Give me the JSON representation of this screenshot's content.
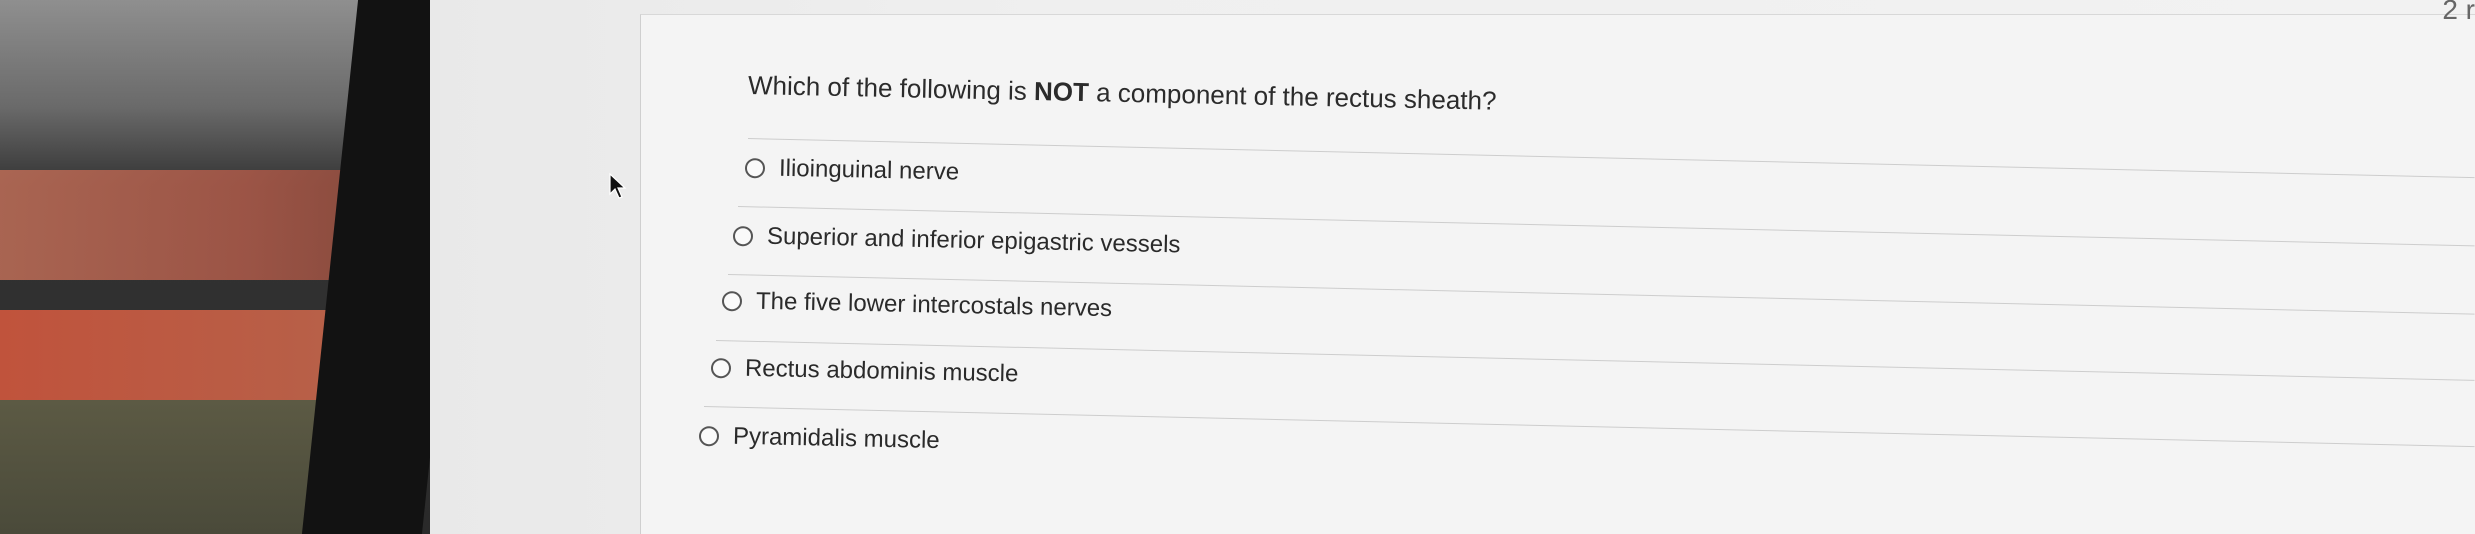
{
  "question": {
    "prefix": "Which of the following is ",
    "emphasis": "NOT",
    "suffix": " a component of the rectus sheath?"
  },
  "options": [
    {
      "label": "Ilioinguinal nerve",
      "selected": false
    },
    {
      "label": "Superior and inferior epigastric vessels",
      "selected": false
    },
    {
      "label": "The five lower intercostals nerves",
      "selected": false
    },
    {
      "label": "Rectus abdominis muscle",
      "selected": false
    },
    {
      "label": "Pyramidalis muscle",
      "selected": false
    }
  ],
  "corner_text": "2 r"
}
